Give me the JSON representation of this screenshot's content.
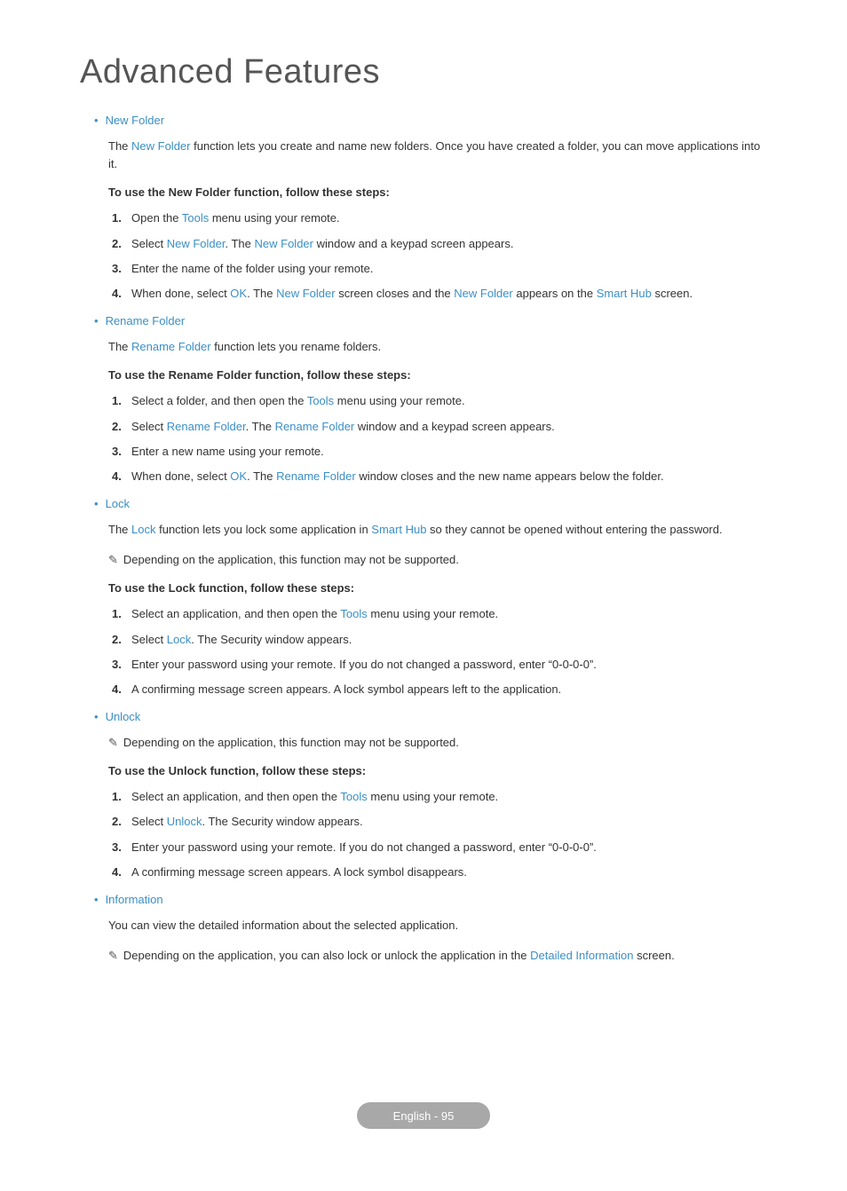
{
  "page_title": "Advanced Features",
  "footer": "English - 95",
  "note_icon": "✎",
  "sections": {
    "new_folder": {
      "bullet": "•",
      "title": "New Folder",
      "desc_pre": "The ",
      "desc_accent": "New Folder",
      "desc_post": " function lets you create and name new folders. Once you have created a folder, you can move applications into it.",
      "steps_heading": "To use the New Folder function, follow these steps:",
      "steps": [
        {
          "n": "1.",
          "pre": "Open the ",
          "a1": "Tools",
          "post": " menu using your remote."
        },
        {
          "n": "2.",
          "pre": "Select ",
          "a1": "New Folder",
          "mid": ". The ",
          "a2": "New Folder",
          "post": " window and a keypad screen appears."
        },
        {
          "n": "3.",
          "pre": "Enter the name of the folder using your remote.",
          "a1": "",
          "post": ""
        },
        {
          "n": "4.",
          "pre": "When done, select ",
          "a1": "OK",
          "mid": ". The ",
          "a2": "New Folder",
          "mid2": " screen closes and the ",
          "a3": "New Folder",
          "mid3": " appears on the ",
          "a4": "Smart Hub",
          "post": " screen."
        }
      ]
    },
    "rename_folder": {
      "bullet": "•",
      "title": "Rename Folder",
      "desc_pre": "The ",
      "desc_accent": "Rename Folder",
      "desc_post": " function lets you rename folders.",
      "steps_heading": "To use the Rename Folder function, follow these steps:",
      "steps": [
        {
          "n": "1.",
          "pre": "Select a folder, and then open the ",
          "a1": "Tools",
          "post": " menu using your remote."
        },
        {
          "n": "2.",
          "pre": "Select ",
          "a1": "Rename Folder",
          "mid": ". The ",
          "a2": "Rename Folder",
          "post": " window and a keypad screen appears."
        },
        {
          "n": "3.",
          "pre": "Enter a new name using your remote.",
          "a1": "",
          "post": ""
        },
        {
          "n": "4.",
          "pre": "When done, select ",
          "a1": "OK",
          "mid": ". The ",
          "a2": "Rename Folder",
          "post": " window closes and the new name appears below the folder."
        }
      ]
    },
    "lock": {
      "bullet": "•",
      "title": "Lock",
      "desc_pre": "The ",
      "desc_a1": "Lock",
      "desc_mid": " function lets you lock some application in ",
      "desc_a2": "Smart Hub",
      "desc_post": " so they cannot be opened without entering the password.",
      "note": "Depending on the application, this function may not be supported.",
      "steps_heading": "To use the Lock function, follow these steps:",
      "steps": [
        {
          "n": "1.",
          "pre": "Select an application, and then open the ",
          "a1": "Tools",
          "post": " menu using your remote."
        },
        {
          "n": "2.",
          "pre": "Select ",
          "a1": "Lock",
          "post": ". The Security window appears."
        },
        {
          "n": "3.",
          "pre": "Enter your password using your remote. If you do not changed a password, enter “0-0-0-0”.",
          "a1": "",
          "post": ""
        },
        {
          "n": "4.",
          "pre": "A confirming message screen appears. A lock symbol appears left to the application.",
          "a1": "",
          "post": ""
        }
      ]
    },
    "unlock": {
      "bullet": "•",
      "title": "Unlock",
      "note": "Depending on the application, this function may not be supported.",
      "steps_heading": "To use the Unlock function, follow these steps:",
      "steps": [
        {
          "n": "1.",
          "pre": "Select an application, and then open the ",
          "a1": "Tools",
          "post": " menu using your remote."
        },
        {
          "n": "2.",
          "pre": "Select ",
          "a1": "Unlock",
          "post": ". The Security window appears."
        },
        {
          "n": "3.",
          "pre": "Enter your password using your remote. If you do not changed a password, enter “0-0-0-0”.",
          "a1": "",
          "post": ""
        },
        {
          "n": "4.",
          "pre": "A confirming message screen appears. A lock symbol disappears.",
          "a1": "",
          "post": ""
        }
      ]
    },
    "information": {
      "bullet": "•",
      "title": "Information",
      "desc": "You can view the detailed information about the selected application.",
      "note_pre": "Depending on the application, you can also lock or unlock the application in the ",
      "note_accent": "Detailed Information",
      "note_post": " screen."
    }
  }
}
